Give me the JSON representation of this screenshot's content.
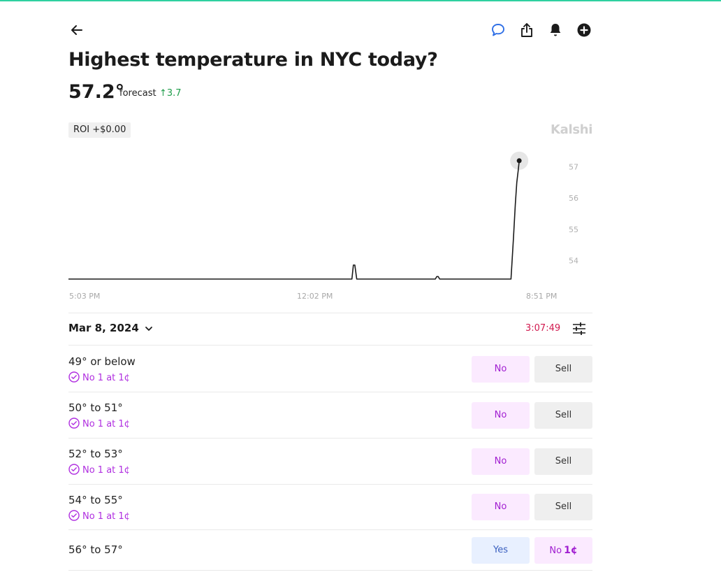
{
  "colors": {
    "accent_top_line": "#2fd0a0",
    "no_purple": "#a11fd1",
    "yes_blue": "#3a5fbf",
    "up_green": "#1f9d4a",
    "timer_red": "#d11a4f",
    "chat_icon_blue": "#2f6fe6"
  },
  "header": {
    "back_icon": "arrow-left-icon",
    "actions": [
      {
        "name": "comment-icon"
      },
      {
        "name": "share-icon"
      },
      {
        "name": "bell-icon"
      },
      {
        "name": "add-circle-icon"
      }
    ],
    "title": "Highest temperature in NYC today?"
  },
  "summary": {
    "value": "57.2°",
    "forecast_label": "forecast",
    "delta": "↑3.7",
    "roi": "ROI +$0.00",
    "brand": "Kalshi"
  },
  "chart_data": {
    "type": "line",
    "x_ticks": [
      "5:03 PM",
      "12:02 PM",
      "8:51 PM"
    ],
    "y_ticks": [
      57,
      56,
      55,
      54
    ],
    "ylim": [
      53.4,
      57.6
    ],
    "grid": false,
    "x": [
      0,
      0.588,
      0.591,
      0.594,
      0.598,
      0.601,
      0.761,
      0.764,
      0.767,
      0.77,
      0.918,
      0.923,
      0.927,
      0.93,
      0.933,
      0.935
    ],
    "y": [
      53.4,
      53.4,
      53.85,
      53.85,
      53.4,
      53.4,
      53.4,
      53.48,
      53.48,
      53.4,
      53.4,
      54.7,
      55.8,
      56.5,
      56.9,
      57.2
    ],
    "x_note": "",
    "endpoint_marker": true
  },
  "date_bar": {
    "date": "Mar 8, 2024",
    "countdown": "3:07:49"
  },
  "rows": [
    {
      "label": "49° or below",
      "position": "No 1 at 1¢",
      "btn1": "No",
      "btn2": "Sell"
    },
    {
      "label": "50° to 51°",
      "position": "No 1 at 1¢",
      "btn1": "No",
      "btn2": "Sell"
    },
    {
      "label": "52° to 53°",
      "position": "No 1 at 1¢",
      "btn1": "No",
      "btn2": "Sell"
    },
    {
      "label": "54° to 55°",
      "position": "No 1 at 1¢",
      "btn1": "No",
      "btn2": "Sell"
    }
  ],
  "last_row": {
    "label": "56° to 57°",
    "yes": "Yes",
    "no": "No",
    "no_price": "1¢"
  }
}
